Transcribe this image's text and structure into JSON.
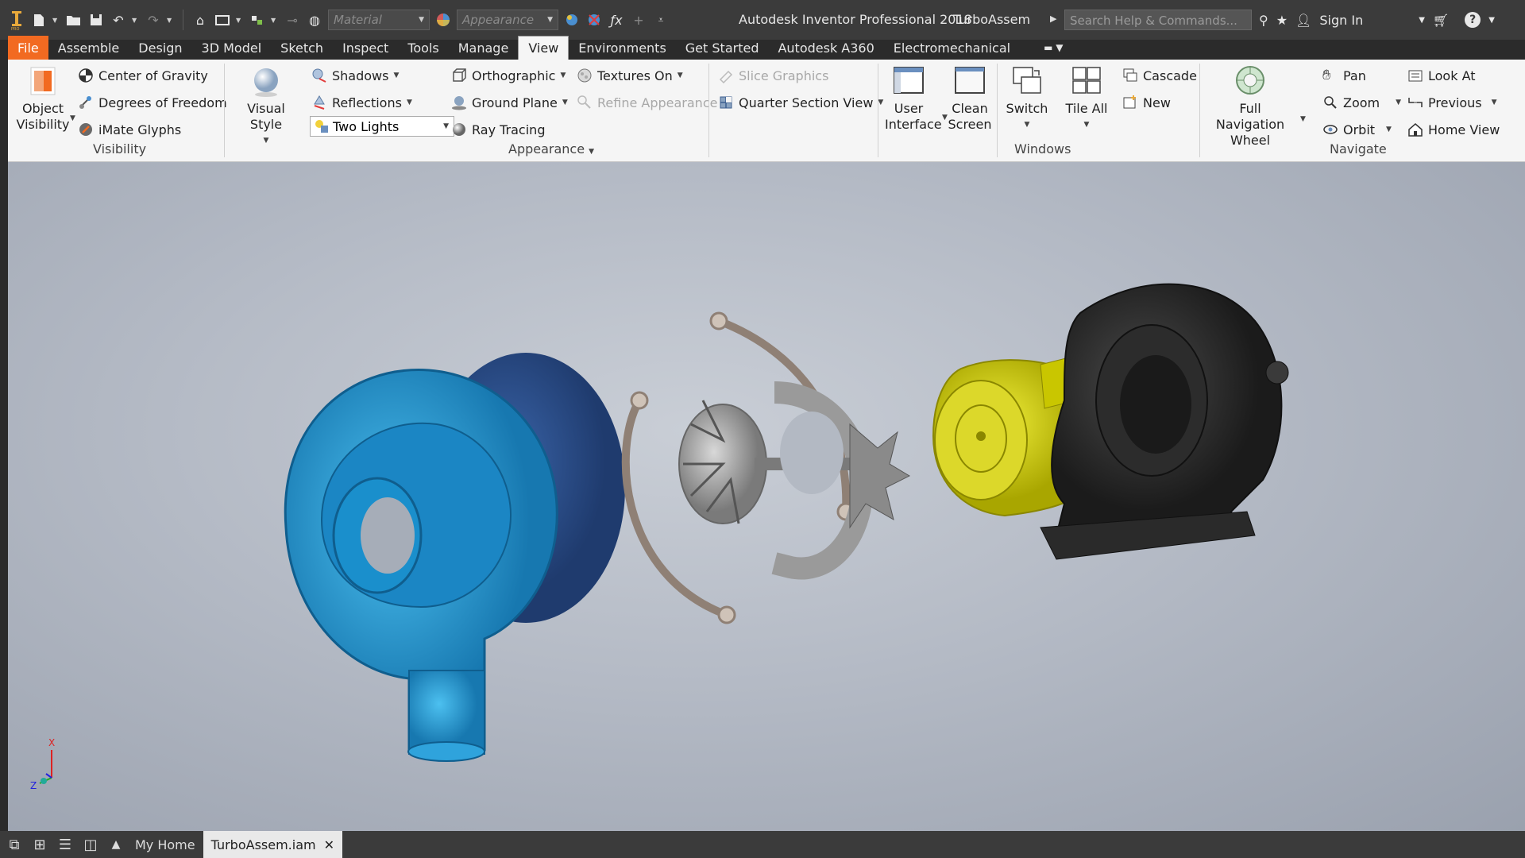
{
  "titlebar": {
    "material_placeholder": "Material",
    "appearance_placeholder": "Appearance",
    "app_title": "Autodesk Inventor Professional 2018",
    "doc_title": "TurboAssem",
    "search_placeholder": "Search Help & Commands...",
    "sign_in": "Sign In"
  },
  "tabs": [
    "File",
    "Assemble",
    "Design",
    "3D Model",
    "Sketch",
    "Inspect",
    "Tools",
    "Manage",
    "View",
    "Environments",
    "Get Started",
    "Autodesk A360",
    "Electromechanical"
  ],
  "ribbon": {
    "visibility": {
      "object_visibility_l1": "Object",
      "object_visibility_l2": "Visibility",
      "center_of_gravity": "Center of Gravity",
      "degrees_of_freedom": "Degrees of Freedom",
      "imate_glyphs": "iMate Glyphs",
      "group_label": "Visibility"
    },
    "appearance": {
      "visual_style": "Visual Style",
      "shadows": "Shadows",
      "reflections": "Reflections",
      "two_lights": "Two Lights",
      "orthographic": "Orthographic",
      "ground_plane": "Ground Plane",
      "ray_tracing": "Ray Tracing",
      "textures_on": "Textures On",
      "refine_appearance": "Refine Appearance",
      "slice_graphics": "Slice Graphics",
      "quarter_section_view": "Quarter Section View",
      "group_label": "Appearance"
    },
    "windows": {
      "user_interface_l1": "User",
      "user_interface_l2": "Interface",
      "clean_screen_l1": "Clean",
      "clean_screen_l2": "Screen",
      "switch": "Switch",
      "tile_all": "Tile All",
      "cascade": "Cascade",
      "new": "New",
      "group_label": "Windows"
    },
    "navigate": {
      "full_nav_wheel_l1": "Full Navigation",
      "full_nav_wheel_l2": "Wheel",
      "pan": "Pan",
      "zoom": "Zoom",
      "orbit": "Orbit",
      "look_at": "Look At",
      "previous": "Previous",
      "home_view": "Home View",
      "group_label": "Navigate"
    }
  },
  "viewport": {
    "axis_x": "X",
    "axis_z": "Z"
  },
  "bottom": {
    "my_home": "My Home",
    "doc_tab": "TurboAssem.iam"
  },
  "colors": {
    "file_tab": "#f26a21",
    "compressor_housing": "#1e9ad6",
    "backplate": "#2d4f8f",
    "clamp_ring": "#8f8075",
    "turbine_housing": "#2a2a2a",
    "yellow_part": "#d8d400"
  }
}
